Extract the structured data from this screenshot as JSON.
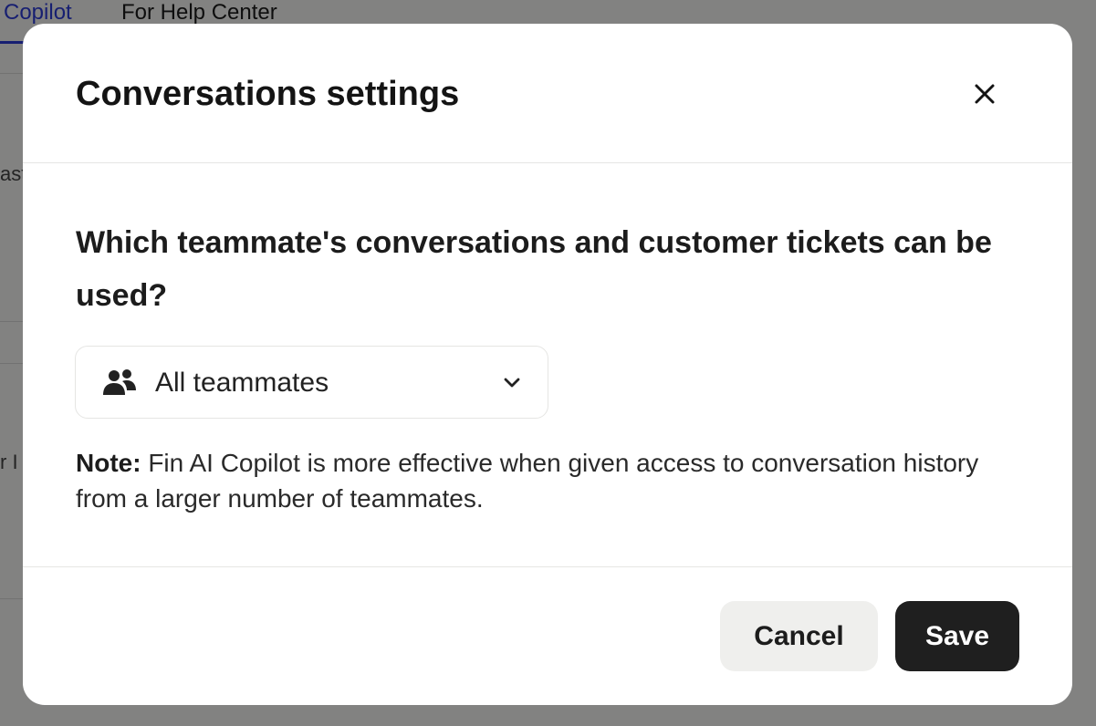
{
  "background": {
    "tabs": [
      {
        "label": "Copilot",
        "active": true
      },
      {
        "label": "For Help Center",
        "active": false
      }
    ],
    "fragments": [
      "ast",
      "r I"
    ]
  },
  "modal": {
    "title": "Conversations settings",
    "close_icon": "close-icon",
    "question": "Which teammate's conversations and customer tickets can be used?",
    "select": {
      "icon": "teammates-icon",
      "value": "All teammates",
      "chevron_icon": "chevron-down-icon"
    },
    "note": {
      "label": "Note:",
      "text": " Fin AI Copilot is more effective when given access to conversation history from a larger number of teammates."
    },
    "buttons": {
      "cancel": "Cancel",
      "save": "Save"
    }
  },
  "colors": {
    "accent": "#2d3bd6",
    "primary_button": "#1f1f1f",
    "secondary_button": "#efefed"
  }
}
